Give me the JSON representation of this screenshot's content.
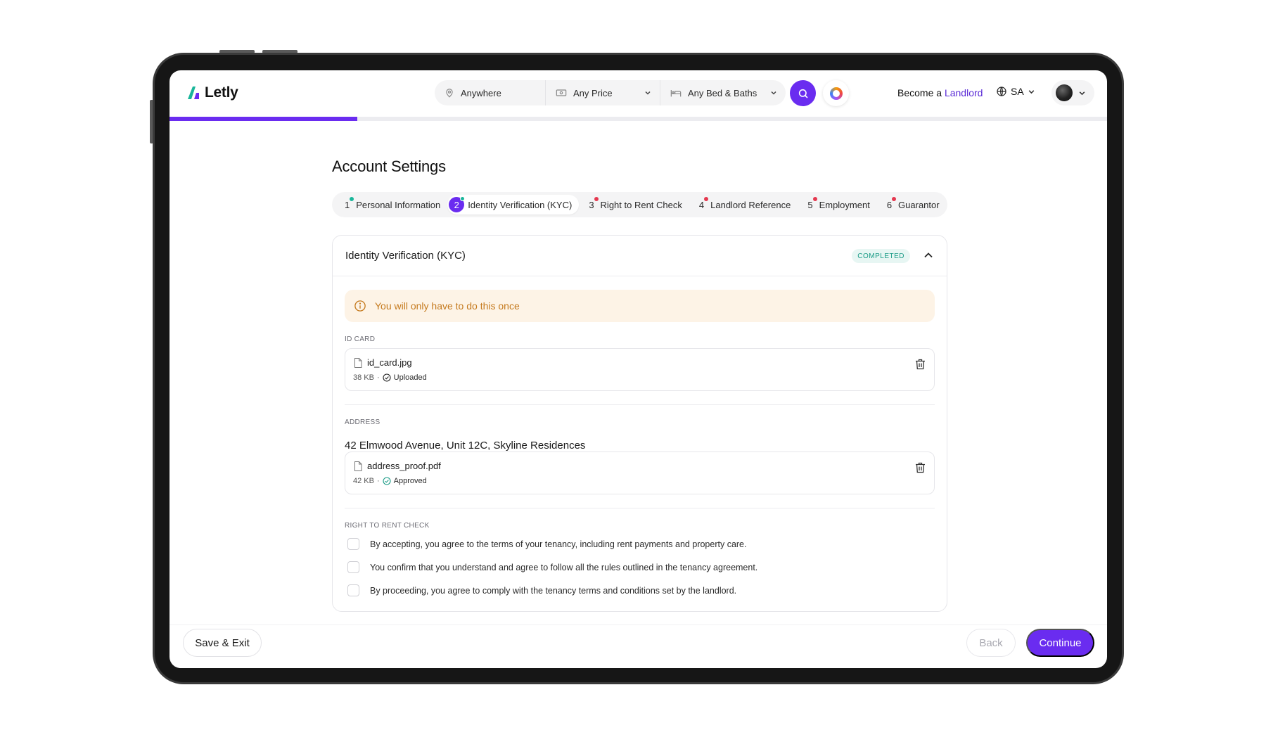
{
  "brand": {
    "name": "Letly",
    "accent": "#6a2cf0",
    "logo_green": "#19b69a"
  },
  "header": {
    "location_label": "Anywhere",
    "price_label": "Any Price",
    "beds_label": "Any Bed & Baths",
    "become_prefix": "Become a",
    "become_accent": "Landlord",
    "language": "SA"
  },
  "progress_fraction": 0.2,
  "page_title": "Account Settings",
  "steps": [
    {
      "num": "1",
      "label": "Personal Information",
      "dot": "#19b69a",
      "active": false
    },
    {
      "num": "2",
      "label": "Identity Verification (KYC)",
      "dot": "#19b69a",
      "active": true
    },
    {
      "num": "3",
      "label": "Right to Rent Check",
      "dot": "#e5384f",
      "active": false
    },
    {
      "num": "4",
      "label": "Landlord Reference",
      "dot": "#e5384f",
      "active": false
    },
    {
      "num": "5",
      "label": "Employment",
      "dot": "#e5384f",
      "active": false
    },
    {
      "num": "6",
      "label": "Guarantor",
      "dot": "#e5384f",
      "active": false
    }
  ],
  "section": {
    "title": "Identity Verification (KYC)",
    "status": "COMPLETED",
    "notice": "You will only have to do this once",
    "id_card": {
      "label": "ID CARD",
      "file_name": "id_card.jpg",
      "size": "38 KB",
      "status": "Uploaded"
    },
    "address": {
      "label": "ADDRESS",
      "value": "42 Elmwood Avenue, Unit 12C, Skyline Residences",
      "file_name": "address_proof.pdf",
      "size": "42 KB",
      "status": "Approved"
    },
    "right_to_rent": {
      "label": "RIGHT TO RENT CHECK",
      "items": [
        "By accepting, you agree to the terms of your tenancy, including rent payments and property care.",
        "You confirm that you understand and agree to follow all the rules outlined in the tenancy agreement.",
        "By proceeding, you agree to comply with the tenancy terms and conditions set by the landlord."
      ]
    }
  },
  "footer": {
    "save_label": "Save & Exit",
    "back_label": "Back",
    "continue_label": "Continue"
  }
}
